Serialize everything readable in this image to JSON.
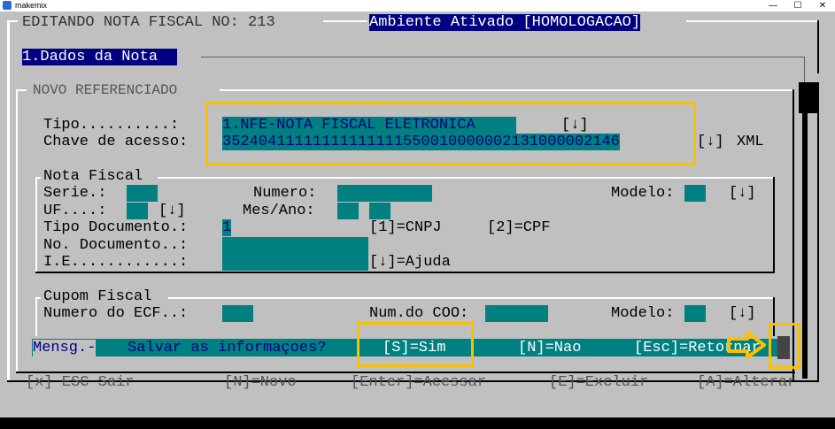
{
  "window": {
    "app_name": "makemix",
    "icon": "app-icon",
    "buttons": [
      "—",
      "☐",
      "✕"
    ]
  },
  "header": {
    "title": "EDITANDO NOTA FISCAL NO: 213",
    "environment": "Ambiente Ativado [HOMOLOGACAO]"
  },
  "tab": {
    "label": "1.Dados da Nota"
  },
  "section": {
    "title": "NOVO REFERENCIADO"
  },
  "tipo": {
    "label": "Tipo..........:",
    "value": "1.NFE-NOTA FISCAL ELETRONICA",
    "dropdown": "[↓]"
  },
  "chave": {
    "label": "Chave de acesso:",
    "value": "35240411111111111111550010000002131000002146",
    "dropdown": "[↓]",
    "xml": "XML"
  },
  "nota_fiscal": {
    "title": "Nota Fiscal",
    "serie_label": "Serie.:",
    "numero_label": "Numero:",
    "modelo_label": "Modelo:",
    "modelo_dropdown": "[↓]",
    "uf_label": "UF....:",
    "uf_dropdown": "[↓]",
    "mes_ano_label": "Mes/Ano:",
    "tipo_doc_label": "Tipo Documento.:",
    "tipo_doc_value": "1",
    "cnpj_option": "[1]=CNPJ",
    "cpf_option": "[2]=CPF",
    "no_doc_label": "No. Documento..:",
    "ie_label": "I.E............:",
    "ajuda": "[↓]=Ajuda"
  },
  "cupom_fiscal": {
    "title": "Cupom Fiscal",
    "ecf_label": "Numero do ECF..:",
    "coo_label": "Num.do COO:",
    "modelo_label": "Modelo:",
    "modelo_dropdown": "[↓]"
  },
  "message": {
    "prefix": "Mensg.-",
    "text": "Salvar as informaçoes?",
    "sim": "[S]=Sim",
    "nao": "[N]=Nao",
    "esc": "[Esc]=Retornar"
  },
  "footer": {
    "items": [
      "[x] ESC Sair",
      "[N]=Novo",
      "[Enter]=Acessar",
      "[E]=Excluir",
      "[A]=Alterar"
    ]
  },
  "colors": {
    "field": "#008080",
    "highlight": "#f9c000",
    "title_bg": "#000080",
    "text_blue": "#000080"
  }
}
